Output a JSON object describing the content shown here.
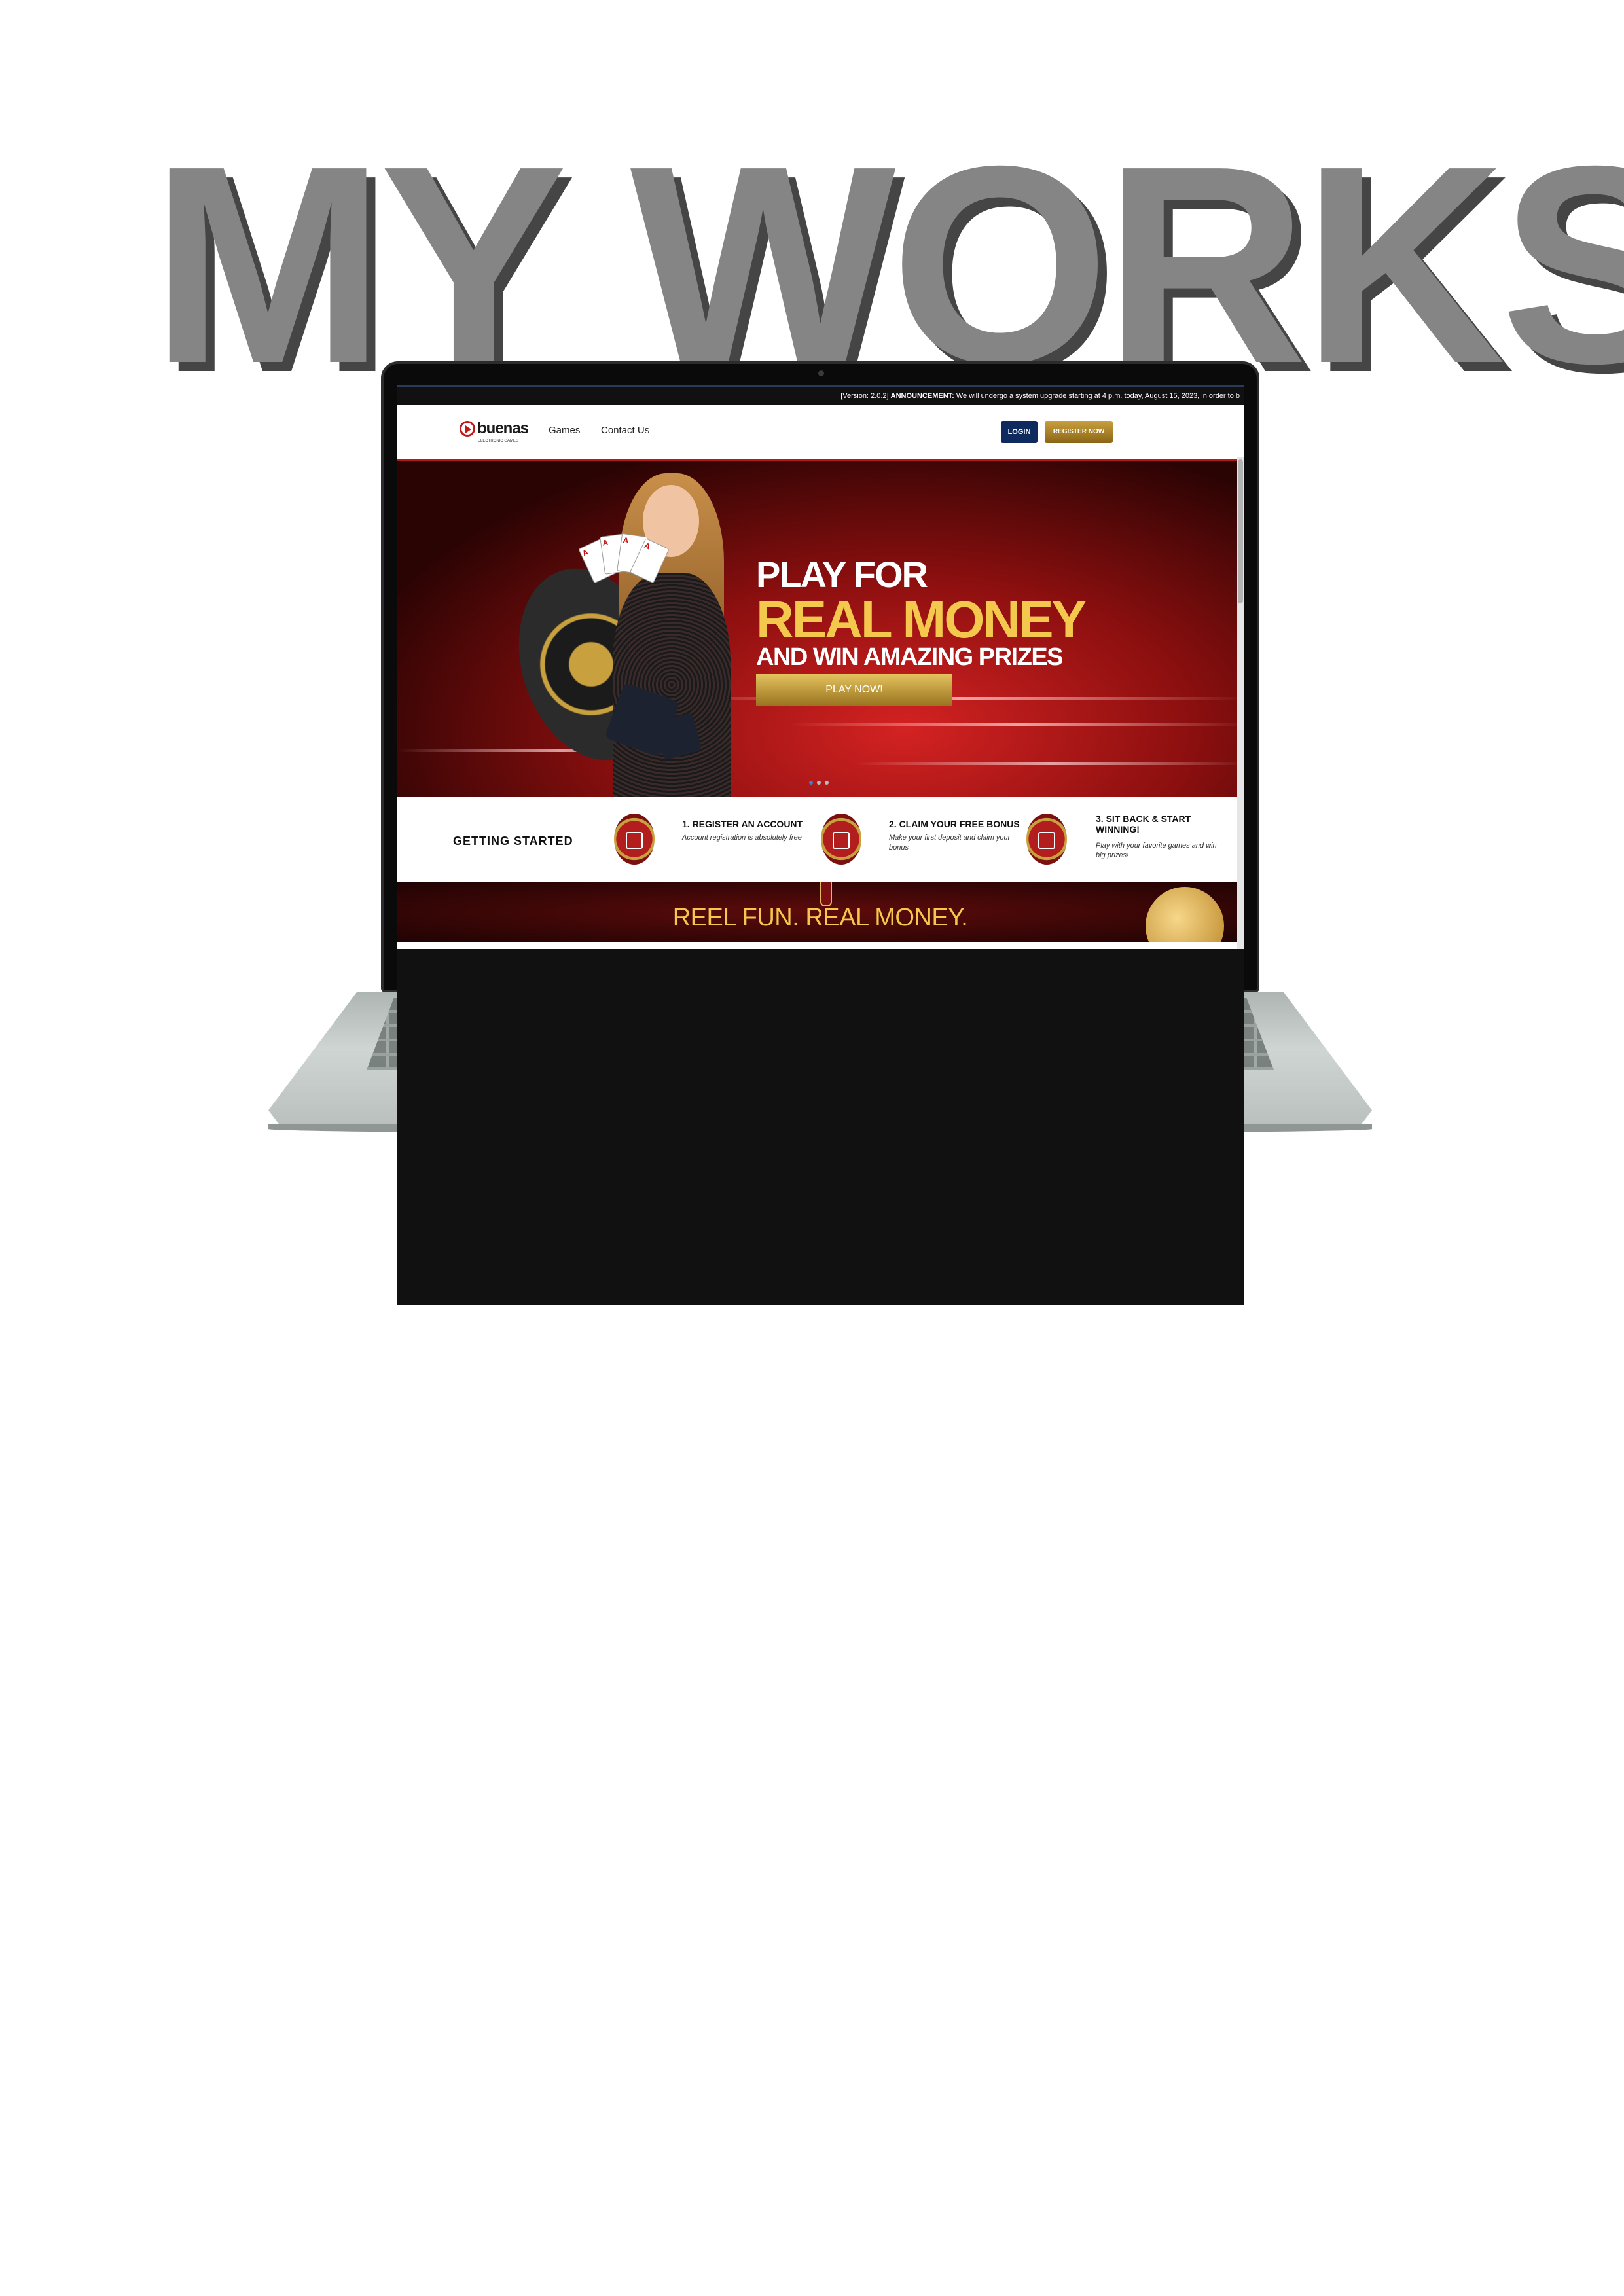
{
  "page": {
    "heading": "MY WORKS"
  },
  "site": {
    "announcement": {
      "version": "[Version: 2.0.2]",
      "label": "ANNOUNCEMENT:",
      "text": "We will undergo a system upgrade starting at 4 p.m. today, August 15, 2023, in order to b"
    },
    "nav": {
      "logo_text": "buenas",
      "logo_sub": "ELECTRONIC GAMES",
      "links": [
        "Games",
        "Contact Us"
      ],
      "login_label": "LOGIN",
      "register_label": "REGISTER NOW"
    },
    "hero": {
      "line1": "PLAY FOR",
      "line2": "REAL MONEY",
      "line3": "AND WIN AMAZING PRIZES",
      "cta": "PLAY NOW!",
      "slides": 3,
      "active_slide": 1
    },
    "getting_started": {
      "title": "GETTING STARTED",
      "steps": [
        {
          "title": "1. REGISTER AN ACCOUNT",
          "desc": "Account registration is absolutely free"
        },
        {
          "title": "2. CLAIM YOUR FREE BONUS",
          "desc": "Make your first deposit and claim your bonus"
        },
        {
          "title": "3. SIT BACK & START WINNING!",
          "desc": "Play with your favorite games and win big prizes!"
        }
      ]
    },
    "band": {
      "text": "REEL FUN. REAL MONEY."
    }
  },
  "colors": {
    "brand_red": "#b31b1b",
    "gold": "#f3c84d",
    "login_blue": "#0f2a5e",
    "heading_gray": "#858585"
  }
}
